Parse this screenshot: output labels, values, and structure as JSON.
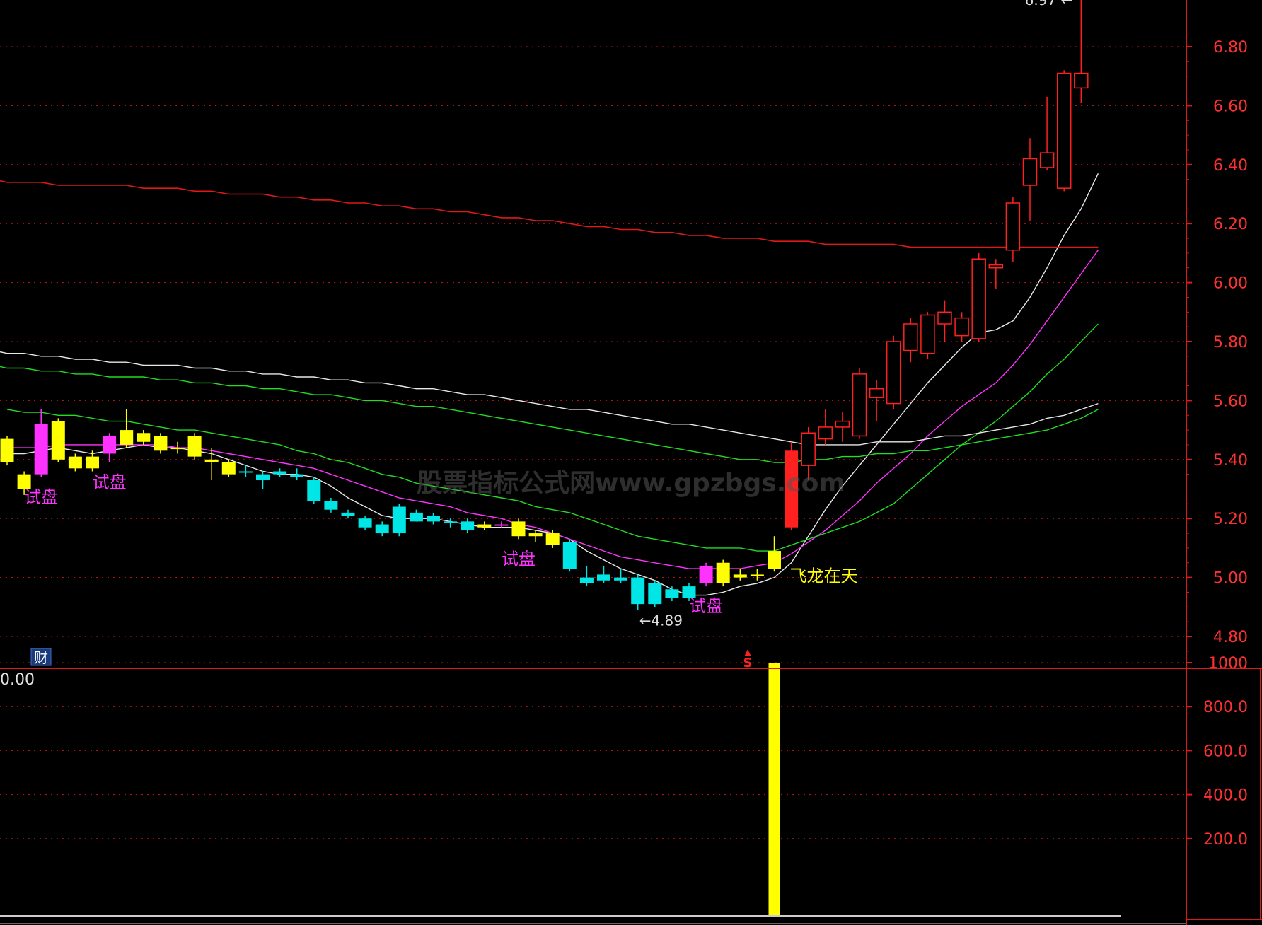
{
  "colors": {
    "background": "#000000",
    "axis": "#e01818",
    "grid": "#c81818",
    "label": "#ff3030",
    "up_candle": "#ff2020",
    "down_candle": "#00e6e6",
    "yellow": "#ffff00",
    "magenta": "#ff33ff",
    "ma_white": "#e8e8e8",
    "ma_magenta": "#ff33ff",
    "ma_green": "#22dd22",
    "ma_green2": "#33cc33",
    "ma_red": "#e01818",
    "watermark": "#555555"
  },
  "watermark": "股票指标公式网www.gpzbgs.com",
  "badges": {
    "cai": "财",
    "s": "S"
  },
  "chart_data": [
    {
      "type": "candlestick",
      "title": "",
      "y_ticks": [
        "6.80",
        "6.60",
        "6.40",
        "6.20",
        "6.00",
        "5.80",
        "5.60",
        "5.40",
        "5.20",
        "5.00",
        "4.80"
      ],
      "ylim": [
        4.72,
        6.92
      ],
      "grid": true,
      "annotations": {
        "high_label": "6.97",
        "low_label": "4.89",
        "signal_label": "飞龙在天",
        "test_label": "试盘"
      },
      "candles": [
        {
          "o": 5.39,
          "c": 5.47,
          "h": 5.48,
          "l": 5.38,
          "color": "yellow"
        },
        {
          "o": 5.35,
          "c": 5.3,
          "h": 5.36,
          "l": 5.28,
          "color": "yellow"
        },
        {
          "o": 5.52,
          "c": 5.35,
          "h": 5.57,
          "l": 5.34,
          "color": "magenta",
          "label": "试盘"
        },
        {
          "o": 5.53,
          "c": 5.4,
          "h": 5.54,
          "l": 5.39,
          "color": "yellow"
        },
        {
          "o": 5.41,
          "c": 5.37,
          "h": 5.42,
          "l": 5.36,
          "color": "yellow"
        },
        {
          "o": 5.37,
          "c": 5.41,
          "h": 5.43,
          "l": 5.36,
          "color": "yellow"
        },
        {
          "o": 5.48,
          "c": 5.42,
          "h": 5.49,
          "l": 5.39,
          "color": "magenta",
          "label": "试盘"
        },
        {
          "o": 5.45,
          "c": 5.5,
          "h": 5.57,
          "l": 5.44,
          "color": "yellow"
        },
        {
          "o": 5.49,
          "c": 5.46,
          "h": 5.5,
          "l": 5.45,
          "color": "yellow"
        },
        {
          "o": 5.48,
          "c": 5.43,
          "h": 5.49,
          "l": 5.42,
          "color": "yellow"
        },
        {
          "o": 5.44,
          "c": 5.44,
          "h": 5.46,
          "l": 5.42,
          "color": "yellow"
        },
        {
          "o": 5.48,
          "c": 5.41,
          "h": 5.49,
          "l": 5.4,
          "color": "yellow"
        },
        {
          "o": 5.4,
          "c": 5.39,
          "h": 5.44,
          "l": 5.33,
          "color": "yellow"
        },
        {
          "o": 5.39,
          "c": 5.35,
          "h": 5.4,
          "l": 5.34,
          "color": "yellow"
        },
        {
          "o": 5.36,
          "c": 5.36,
          "h": 5.38,
          "l": 5.34,
          "color": "cyan"
        },
        {
          "o": 5.35,
          "c": 5.33,
          "h": 5.36,
          "l": 5.3,
          "color": "cyan"
        },
        {
          "o": 5.36,
          "c": 5.35,
          "h": 5.37,
          "l": 5.34,
          "color": "cyan"
        },
        {
          "o": 5.35,
          "c": 5.34,
          "h": 5.37,
          "l": 5.33,
          "color": "cyan"
        },
        {
          "o": 5.33,
          "c": 5.26,
          "h": 5.34,
          "l": 5.25,
          "color": "cyan"
        },
        {
          "o": 5.26,
          "c": 5.23,
          "h": 5.27,
          "l": 5.22,
          "color": "cyan"
        },
        {
          "o": 5.22,
          "c": 5.21,
          "h": 5.23,
          "l": 5.2,
          "color": "cyan"
        },
        {
          "o": 5.2,
          "c": 5.17,
          "h": 5.21,
          "l": 5.16,
          "color": "cyan"
        },
        {
          "o": 5.18,
          "c": 5.15,
          "h": 5.19,
          "l": 5.14,
          "color": "cyan"
        },
        {
          "o": 5.24,
          "c": 5.15,
          "h": 5.25,
          "l": 5.14,
          "color": "cyan"
        },
        {
          "o": 5.22,
          "c": 5.19,
          "h": 5.23,
          "l": 5.19,
          "color": "cyan"
        },
        {
          "o": 5.21,
          "c": 5.19,
          "h": 5.22,
          "l": 5.18,
          "color": "cyan"
        },
        {
          "o": 5.19,
          "c": 5.19,
          "h": 5.2,
          "l": 5.17,
          "color": "cyan"
        },
        {
          "o": 5.19,
          "c": 5.16,
          "h": 5.2,
          "l": 5.15,
          "color": "cyan"
        },
        {
          "o": 5.18,
          "c": 5.17,
          "h": 5.19,
          "l": 5.16,
          "color": "yellow"
        },
        {
          "o": 5.18,
          "c": 5.18,
          "h": 5.19,
          "l": 5.17,
          "color": "magenta"
        },
        {
          "o": 5.19,
          "c": 5.14,
          "h": 5.2,
          "l": 5.13,
          "color": "yellow",
          "label": "试盘"
        },
        {
          "o": 5.15,
          "c": 5.14,
          "h": 5.16,
          "l": 5.12,
          "color": "yellow"
        },
        {
          "o": 5.15,
          "c": 5.11,
          "h": 5.16,
          "l": 5.1,
          "color": "yellow"
        },
        {
          "o": 5.12,
          "c": 5.03,
          "h": 5.13,
          "l": 5.02,
          "color": "cyan"
        },
        {
          "o": 5.0,
          "c": 4.98,
          "h": 5.04,
          "l": 4.97,
          "color": "cyan"
        },
        {
          "o": 5.01,
          "c": 4.99,
          "h": 5.04,
          "l": 4.98,
          "color": "cyan"
        },
        {
          "o": 5.0,
          "c": 4.99,
          "h": 5.03,
          "l": 4.98,
          "color": "cyan"
        },
        {
          "o": 5.0,
          "c": 4.91,
          "h": 5.01,
          "l": 4.89,
          "color": "cyan"
        },
        {
          "o": 4.98,
          "c": 4.91,
          "h": 4.99,
          "l": 4.9,
          "color": "cyan"
        },
        {
          "o": 4.96,
          "c": 4.93,
          "h": 4.97,
          "l": 4.92,
          "color": "cyan"
        },
        {
          "o": 4.97,
          "c": 4.93,
          "h": 4.98,
          "l": 4.92,
          "color": "cyan"
        },
        {
          "o": 5.04,
          "c": 4.98,
          "h": 5.05,
          "l": 4.97,
          "color": "magenta",
          "label": "试盘"
        },
        {
          "o": 5.05,
          "c": 4.98,
          "h": 5.06,
          "l": 4.97,
          "color": "yellow"
        },
        {
          "o": 5.01,
          "c": 5.0,
          "h": 5.03,
          "l": 4.99,
          "color": "yellow"
        },
        {
          "o": 5.01,
          "c": 5.01,
          "h": 5.03,
          "l": 4.99,
          "color": "yellow"
        },
        {
          "o": 5.03,
          "c": 5.09,
          "h": 5.14,
          "l": 5.02,
          "color": "yellow",
          "label": "飞龙在天"
        },
        {
          "o": 5.17,
          "c": 5.43,
          "h": 5.46,
          "l": 5.16,
          "color": "red"
        },
        {
          "o": 5.38,
          "c": 5.49,
          "h": 5.51,
          "l": 5.33,
          "color": "red_hollow"
        },
        {
          "o": 5.47,
          "c": 5.51,
          "h": 5.57,
          "l": 5.45,
          "color": "red_hollow"
        },
        {
          "o": 5.51,
          "c": 5.53,
          "h": 5.56,
          "l": 5.46,
          "color": "red_hollow"
        },
        {
          "o": 5.48,
          "c": 5.69,
          "h": 5.71,
          "l": 5.47,
          "color": "red_hollow"
        },
        {
          "o": 5.61,
          "c": 5.64,
          "h": 5.67,
          "l": 5.53,
          "color": "red_hollow"
        },
        {
          "o": 5.59,
          "c": 5.8,
          "h": 5.82,
          "l": 5.57,
          "color": "red_hollow"
        },
        {
          "o": 5.77,
          "c": 5.86,
          "h": 5.88,
          "l": 5.73,
          "color": "red_hollow"
        },
        {
          "o": 5.76,
          "c": 5.89,
          "h": 5.9,
          "l": 5.74,
          "color": "red_hollow"
        },
        {
          "o": 5.86,
          "c": 5.9,
          "h": 5.94,
          "l": 5.8,
          "color": "red_hollow"
        },
        {
          "o": 5.82,
          "c": 5.88,
          "h": 5.9,
          "l": 5.8,
          "color": "red_hollow"
        },
        {
          "o": 5.81,
          "c": 6.08,
          "h": 6.1,
          "l": 5.8,
          "color": "red_hollow"
        },
        {
          "o": 6.05,
          "c": 6.06,
          "h": 6.08,
          "l": 5.98,
          "color": "red_hollow"
        },
        {
          "o": 6.11,
          "c": 6.27,
          "h": 6.29,
          "l": 6.07,
          "color": "red_hollow"
        },
        {
          "o": 6.33,
          "c": 6.42,
          "h": 6.49,
          "l": 6.21,
          "color": "red_hollow"
        },
        {
          "o": 6.39,
          "c": 6.44,
          "h": 6.63,
          "l": 6.38,
          "color": "red_hollow"
        },
        {
          "o": 6.32,
          "c": 6.71,
          "h": 6.72,
          "l": 6.31,
          "color": "red_hollow"
        },
        {
          "o": 6.66,
          "c": 6.71,
          "h": 6.97,
          "l": 6.61,
          "color": "red_hollow"
        }
      ],
      "moving_averages": [
        {
          "color": "white",
          "values": [
            5.42,
            5.42,
            5.43,
            5.44,
            5.43,
            5.42,
            5.43,
            5.44,
            5.45,
            5.44,
            5.44,
            5.43,
            5.42,
            5.4,
            5.38,
            5.36,
            5.35,
            5.35,
            5.34,
            5.31,
            5.27,
            5.24,
            5.21,
            5.2,
            5.2,
            5.2,
            5.19,
            5.18,
            5.17,
            5.17,
            5.17,
            5.16,
            5.15,
            5.13,
            5.09,
            5.06,
            5.03,
            5.01,
            4.99,
            4.96,
            4.94,
            4.94,
            4.95,
            4.97,
            4.98,
            5.0,
            5.05,
            5.14,
            5.23,
            5.31,
            5.38,
            5.45,
            5.52,
            5.59,
            5.66,
            5.72,
            5.78,
            5.83,
            5.84,
            5.87,
            5.95,
            6.05,
            6.16,
            6.25,
            6.37
          ]
        },
        {
          "color": "magenta",
          "values": [
            5.44,
            5.44,
            5.44,
            5.45,
            5.45,
            5.45,
            5.45,
            5.45,
            5.45,
            5.45,
            5.44,
            5.44,
            5.43,
            5.42,
            5.41,
            5.4,
            5.39,
            5.38,
            5.37,
            5.35,
            5.33,
            5.31,
            5.29,
            5.27,
            5.26,
            5.25,
            5.24,
            5.22,
            5.21,
            5.2,
            5.18,
            5.17,
            5.15,
            5.13,
            5.11,
            5.09,
            5.07,
            5.06,
            5.05,
            5.04,
            5.03,
            5.03,
            5.03,
            5.03,
            5.04,
            5.05,
            5.08,
            5.12,
            5.16,
            5.21,
            5.26,
            5.32,
            5.37,
            5.42,
            5.48,
            5.53,
            5.58,
            5.62,
            5.66,
            5.72,
            5.79,
            5.87,
            5.95,
            6.03,
            6.11
          ]
        },
        {
          "color": "green",
          "values": [
            5.57,
            5.56,
            5.56,
            5.55,
            5.55,
            5.54,
            5.53,
            5.53,
            5.52,
            5.51,
            5.5,
            5.5,
            5.49,
            5.48,
            5.47,
            5.46,
            5.45,
            5.43,
            5.42,
            5.4,
            5.39,
            5.37,
            5.35,
            5.34,
            5.32,
            5.31,
            5.3,
            5.29,
            5.28,
            5.27,
            5.26,
            5.24,
            5.23,
            5.22,
            5.2,
            5.18,
            5.16,
            5.14,
            5.13,
            5.12,
            5.11,
            5.1,
            5.1,
            5.1,
            5.09,
            5.09,
            5.11,
            5.13,
            5.15,
            5.17,
            5.19,
            5.22,
            5.25,
            5.3,
            5.35,
            5.4,
            5.45,
            5.49,
            5.53,
            5.58,
            5.63,
            5.69,
            5.74,
            5.8,
            5.86
          ]
        },
        {
          "color": "white",
          "values": [
            5.76,
            5.76,
            5.75,
            5.75,
            5.74,
            5.74,
            5.73,
            5.73,
            5.72,
            5.72,
            5.72,
            5.71,
            5.71,
            5.7,
            5.7,
            5.69,
            5.69,
            5.68,
            5.68,
            5.67,
            5.67,
            5.66,
            5.66,
            5.65,
            5.64,
            5.64,
            5.63,
            5.62,
            5.62,
            5.61,
            5.6,
            5.59,
            5.58,
            5.57,
            5.57,
            5.56,
            5.55,
            5.54,
            5.53,
            5.52,
            5.52,
            5.51,
            5.5,
            5.49,
            5.48,
            5.47,
            5.46,
            5.45,
            5.45,
            5.45,
            5.45,
            5.46,
            5.46,
            5.46,
            5.47,
            5.48,
            5.48,
            5.49,
            5.5,
            5.51,
            5.52,
            5.54,
            5.55,
            5.57,
            5.59
          ]
        },
        {
          "color": "green",
          "values": [
            5.71,
            5.71,
            5.7,
            5.7,
            5.69,
            5.69,
            5.68,
            5.68,
            5.68,
            5.67,
            5.67,
            5.66,
            5.66,
            5.65,
            5.65,
            5.64,
            5.64,
            5.63,
            5.62,
            5.62,
            5.61,
            5.6,
            5.6,
            5.59,
            5.58,
            5.58,
            5.57,
            5.56,
            5.55,
            5.54,
            5.53,
            5.52,
            5.51,
            5.5,
            5.49,
            5.48,
            5.47,
            5.46,
            5.45,
            5.44,
            5.43,
            5.42,
            5.41,
            5.4,
            5.4,
            5.39,
            5.39,
            5.4,
            5.4,
            5.41,
            5.41,
            5.42,
            5.42,
            5.43,
            5.43,
            5.44,
            5.45,
            5.46,
            5.47,
            5.48,
            5.49,
            5.5,
            5.52,
            5.54,
            5.57
          ]
        },
        {
          "color": "red",
          "values": [
            6.34,
            6.34,
            6.34,
            6.33,
            6.33,
            6.33,
            6.33,
            6.33,
            6.32,
            6.32,
            6.32,
            6.31,
            6.31,
            6.3,
            6.3,
            6.3,
            6.29,
            6.29,
            6.28,
            6.28,
            6.27,
            6.27,
            6.26,
            6.26,
            6.25,
            6.25,
            6.24,
            6.24,
            6.23,
            6.22,
            6.22,
            6.21,
            6.21,
            6.2,
            6.19,
            6.19,
            6.18,
            6.18,
            6.17,
            6.17,
            6.16,
            6.16,
            6.15,
            6.15,
            6.15,
            6.14,
            6.14,
            6.14,
            6.13,
            6.13,
            6.13,
            6.13,
            6.13,
            6.12,
            6.12,
            6.12,
            6.12,
            6.12,
            6.12,
            6.12,
            6.12,
            6.12,
            6.12,
            6.12,
            6.12
          ]
        }
      ]
    },
    {
      "type": "bar",
      "title": "",
      "current_value": "0.00",
      "y_ticks": [
        "1000",
        "800.0",
        "600.0",
        "400.0",
        "200.0"
      ],
      "ylim": [
        0,
        1000
      ],
      "grid": true,
      "bars": [
        {
          "index": 45,
          "value": 1000,
          "color": "yellow"
        }
      ]
    }
  ]
}
